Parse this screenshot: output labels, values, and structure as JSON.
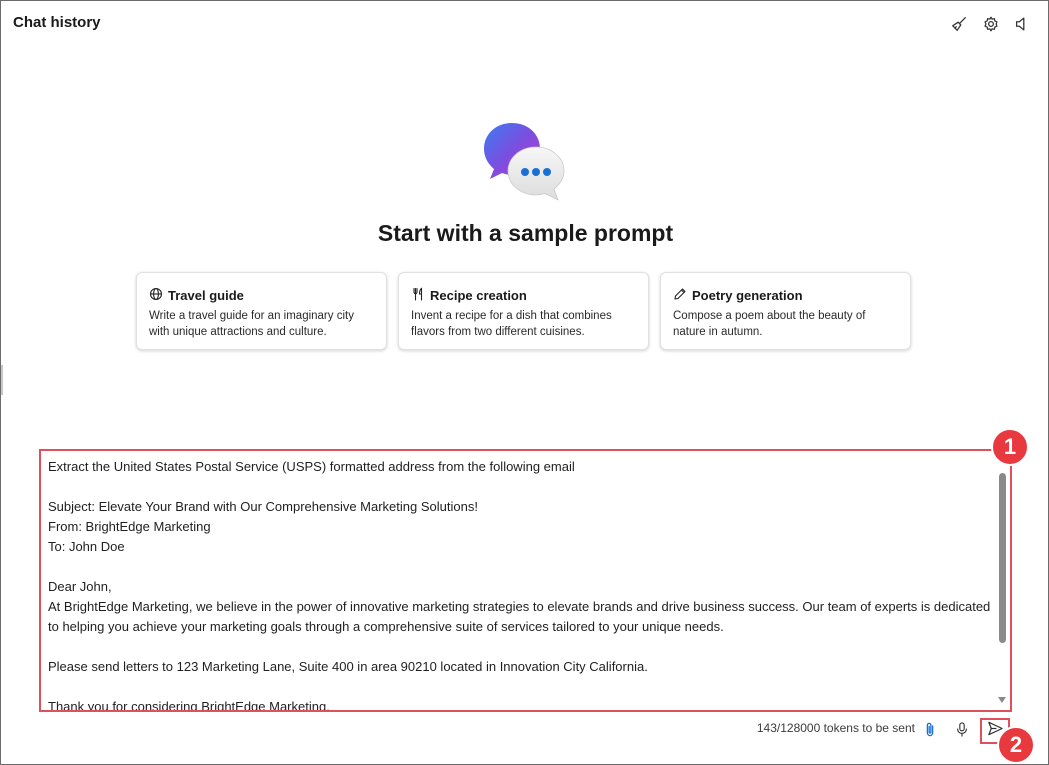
{
  "header": {
    "title": "Chat history",
    "icons": [
      "broom-icon",
      "gear-icon",
      "speaker-icon"
    ]
  },
  "hero": {
    "title": "Start with a sample prompt"
  },
  "cards": [
    {
      "icon": "globe-icon",
      "title": "Travel guide",
      "description": "Write a travel guide for an imaginary city with unique attractions and culture."
    },
    {
      "icon": "utensils-icon",
      "title": "Recipe creation",
      "description": "Invent a recipe for a dish that combines flavors from two different cuisines."
    },
    {
      "icon": "pen-icon",
      "title": "Poetry generation",
      "description": "Compose a poem about the beauty of nature in autumn."
    }
  ],
  "prompt": {
    "text": "Extract the United States Postal Service (USPS) formatted address from the following email\n\nSubject: Elevate Your Brand with Our Comprehensive Marketing Solutions!\nFrom: BrightEdge Marketing\nTo: John Doe\n\nDear John,\nAt BrightEdge Marketing, we believe in the power of innovative marketing strategies to elevate brands and drive business success. Our team of experts is dedicated to helping you achieve your marketing goals through a comprehensive suite of services tailored to your unique needs.\n\nPlease send letters to 123 Marketing Lane, Suite 400 in area 90210 located in Innovation City California.\n\nThank you for considering BrightEdge Marketing."
  },
  "footer": {
    "token_count": "143/128000 tokens to be sent",
    "icons": [
      "paperclip-icon",
      "microphone-icon",
      "send-icon"
    ]
  },
  "annotations": {
    "badge1": "1",
    "badge2": "2"
  },
  "colors": {
    "highlight": "#e0505a",
    "badge": "#e8393f",
    "accent_blue": "#1a6fd4"
  }
}
